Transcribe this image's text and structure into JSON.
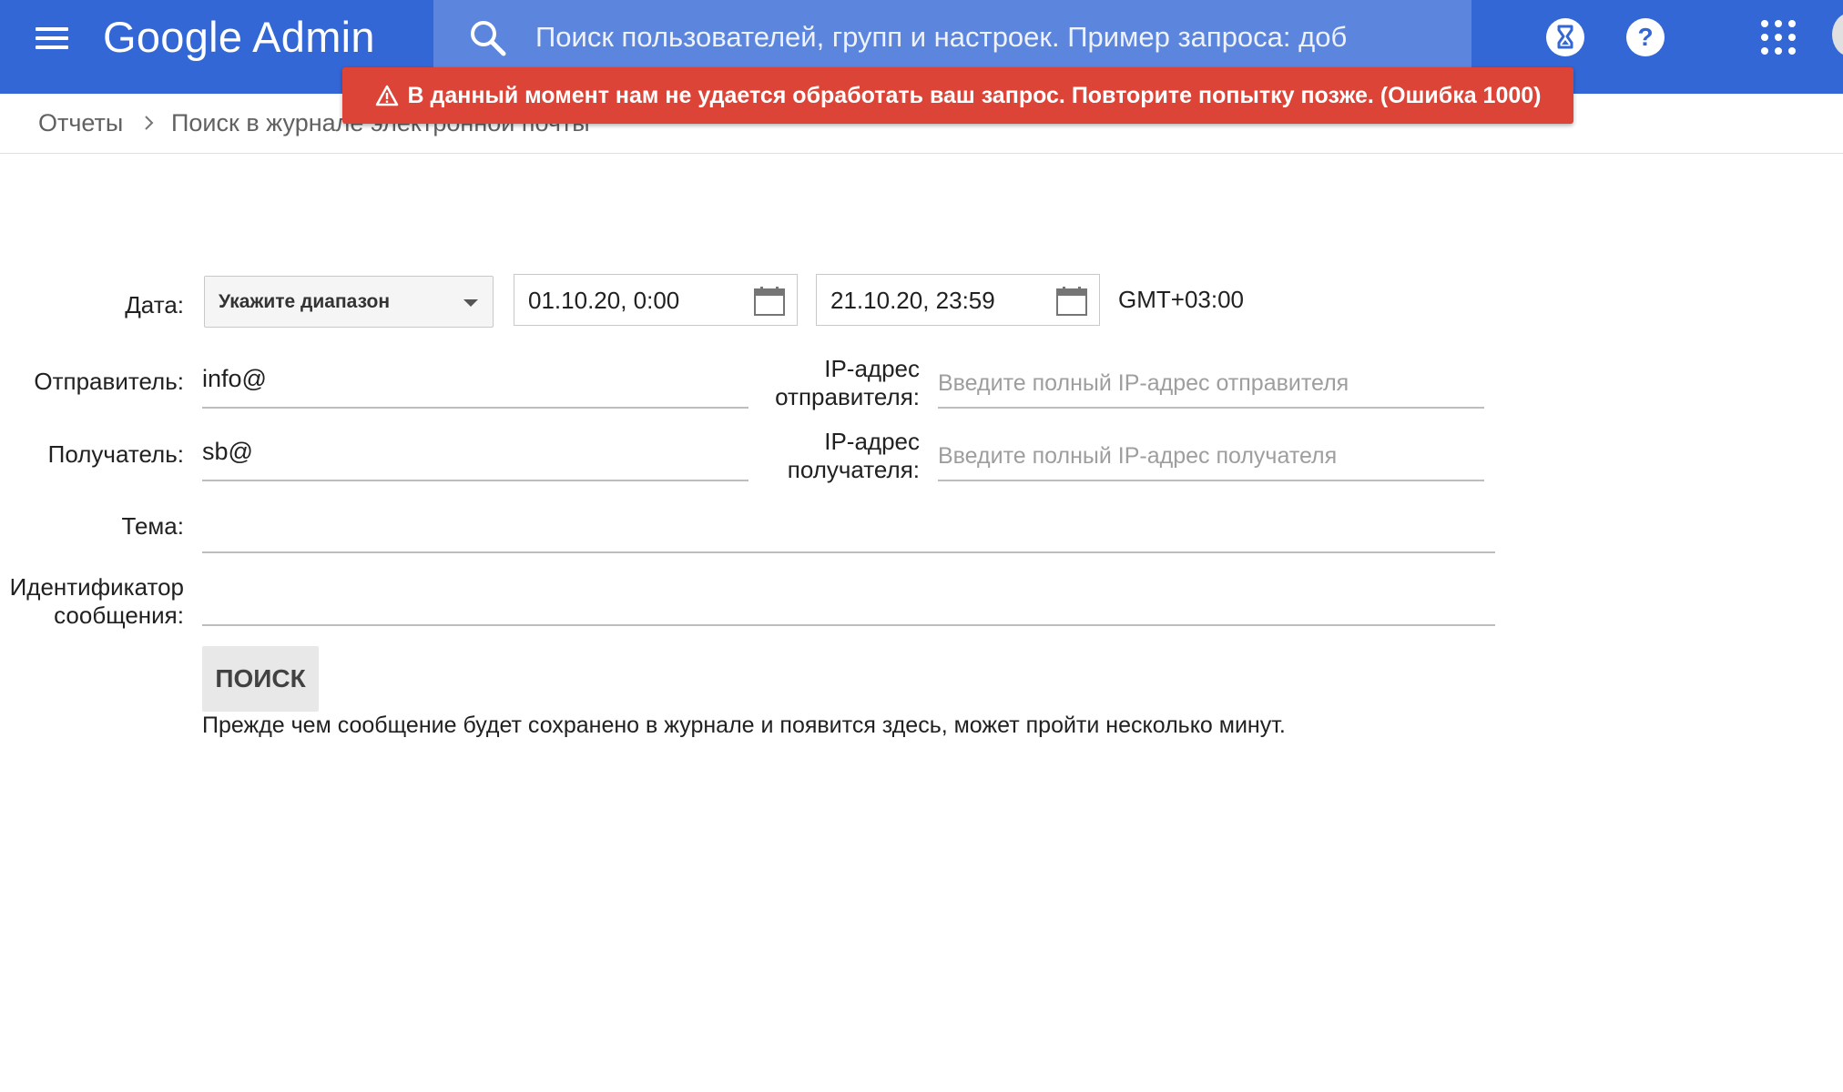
{
  "header": {
    "logo_google": "Google",
    "logo_admin": "Admin",
    "search_placeholder": "Поиск пользователей, групп и настроек. Пример запроса: доб",
    "icons": [
      "menu-icon",
      "search-icon",
      "hourglass-icon",
      "help-icon",
      "apps-grid-icon",
      "avatar"
    ]
  },
  "error_banner": {
    "text": "В данный момент нам не удается обработать ваш запрос. Повторите попытку позже. (Ошибка 1000)",
    "color": "#db4437"
  },
  "breadcrumb": {
    "parent": "Отчеты",
    "current": "Поиск в журнале электронной почты"
  },
  "form": {
    "date_label": "Дата:",
    "date_range_select": "Укажите диапазон",
    "date_from": "01.10.20, 0:00",
    "date_to": "21.10.20, 23:59",
    "timezone": "GMT+03:00",
    "sender_label": "Отправитель:",
    "sender_value": "info@",
    "sender_ip_label_line1": "IP-адрес",
    "sender_ip_label_line2": "отправителя:",
    "sender_ip_placeholder": "Введите полный IP-адрес отправителя",
    "recipient_label": "Получатель:",
    "recipient_value": "sb@",
    "recipient_ip_label_line1": "IP-адрес",
    "recipient_ip_label_line2": "получателя:",
    "recipient_ip_placeholder": "Введите полный IP-адрес получателя",
    "subject_label": "Тема:",
    "subject_value": "",
    "message_id_label_line1": "Идентификатор",
    "message_id_label_line2": "сообщения:",
    "message_id_value": "",
    "search_button": "ПОИСК",
    "note": "Прежде чем сообщение будет сохранено в журнале и появится здесь, может пройти несколько минут."
  },
  "colors": {
    "appbar": "#3367d6",
    "search_bar": "#5c85dd",
    "error": "#db4437"
  }
}
